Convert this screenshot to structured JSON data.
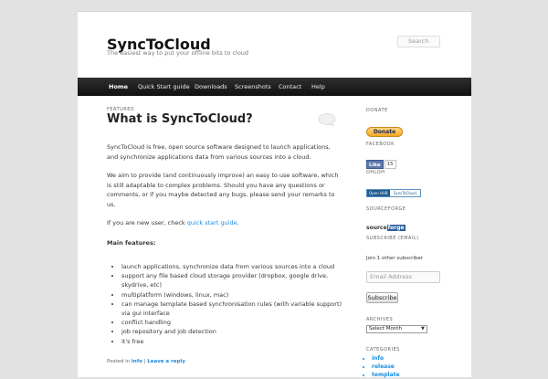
{
  "site": {
    "title": "SyncToCloud",
    "tagline": "The easiest way to put your offline bits to cloud"
  },
  "search": {
    "placeholder": "Search"
  },
  "nav": [
    "Home",
    "Quick Start guide",
    "Downloads",
    "Screenshots",
    "Contact",
    "Help"
  ],
  "post": {
    "label": "FEATURED",
    "title": "What is SyncToCloud?",
    "p1": "SyncToCloud is free, open source software designed to launch applications, and synchronize applications data from various sources into a cloud.",
    "p2": "We aim to provide (and continuously improve) an easy to use software, which is still adaptable to complex problems. Should you have any questions or comments, or if you maybe detected any bugs, please send your remarks to us.",
    "p3_prefix": "If you are new user, check ",
    "p3_link": "quick start guide",
    "p3_suffix": ".",
    "features_heading": "Main features:",
    "features": [
      "launch applications, synchronize data from various sources into a cloud",
      "support any file based cloud storage provider (dropbox, google drive, skydrive, etc)",
      "multiplatform (windows, linux, mac)",
      "can manage template based synchronisation rules (with variable support) via gui interface",
      "conflict handling",
      "job repository and job detection",
      "it's free"
    ],
    "meta_prefix": "Posted in ",
    "meta_category": "info",
    "meta_sep": " | ",
    "meta_reply": "Leave a reply"
  },
  "sidebar": {
    "donate_title": "DONATE",
    "donate_button": "Donate",
    "facebook_title": "FACEBOOK",
    "fb_like": "Like",
    "fb_count": "15",
    "ohloh_title": "OHLOH",
    "ohloh_left": "Open HUB",
    "ohloh_right": "SyncToCloud",
    "sourceforge_title": "SOURCEFORGE",
    "sf_a": "source",
    "sf_b": "forge",
    "subscribe_title": "SUBSCRIBE (EMAIL)",
    "subscribe_text": "Join 1 other subscriber",
    "email_placeholder": "Email Address",
    "subscribe_button": "Subscribe",
    "archives_title": "ARCHIVES",
    "archives_select": "Select Month",
    "categories_title": "CATEGORIES",
    "categories": [
      "info",
      "release",
      "template"
    ]
  }
}
